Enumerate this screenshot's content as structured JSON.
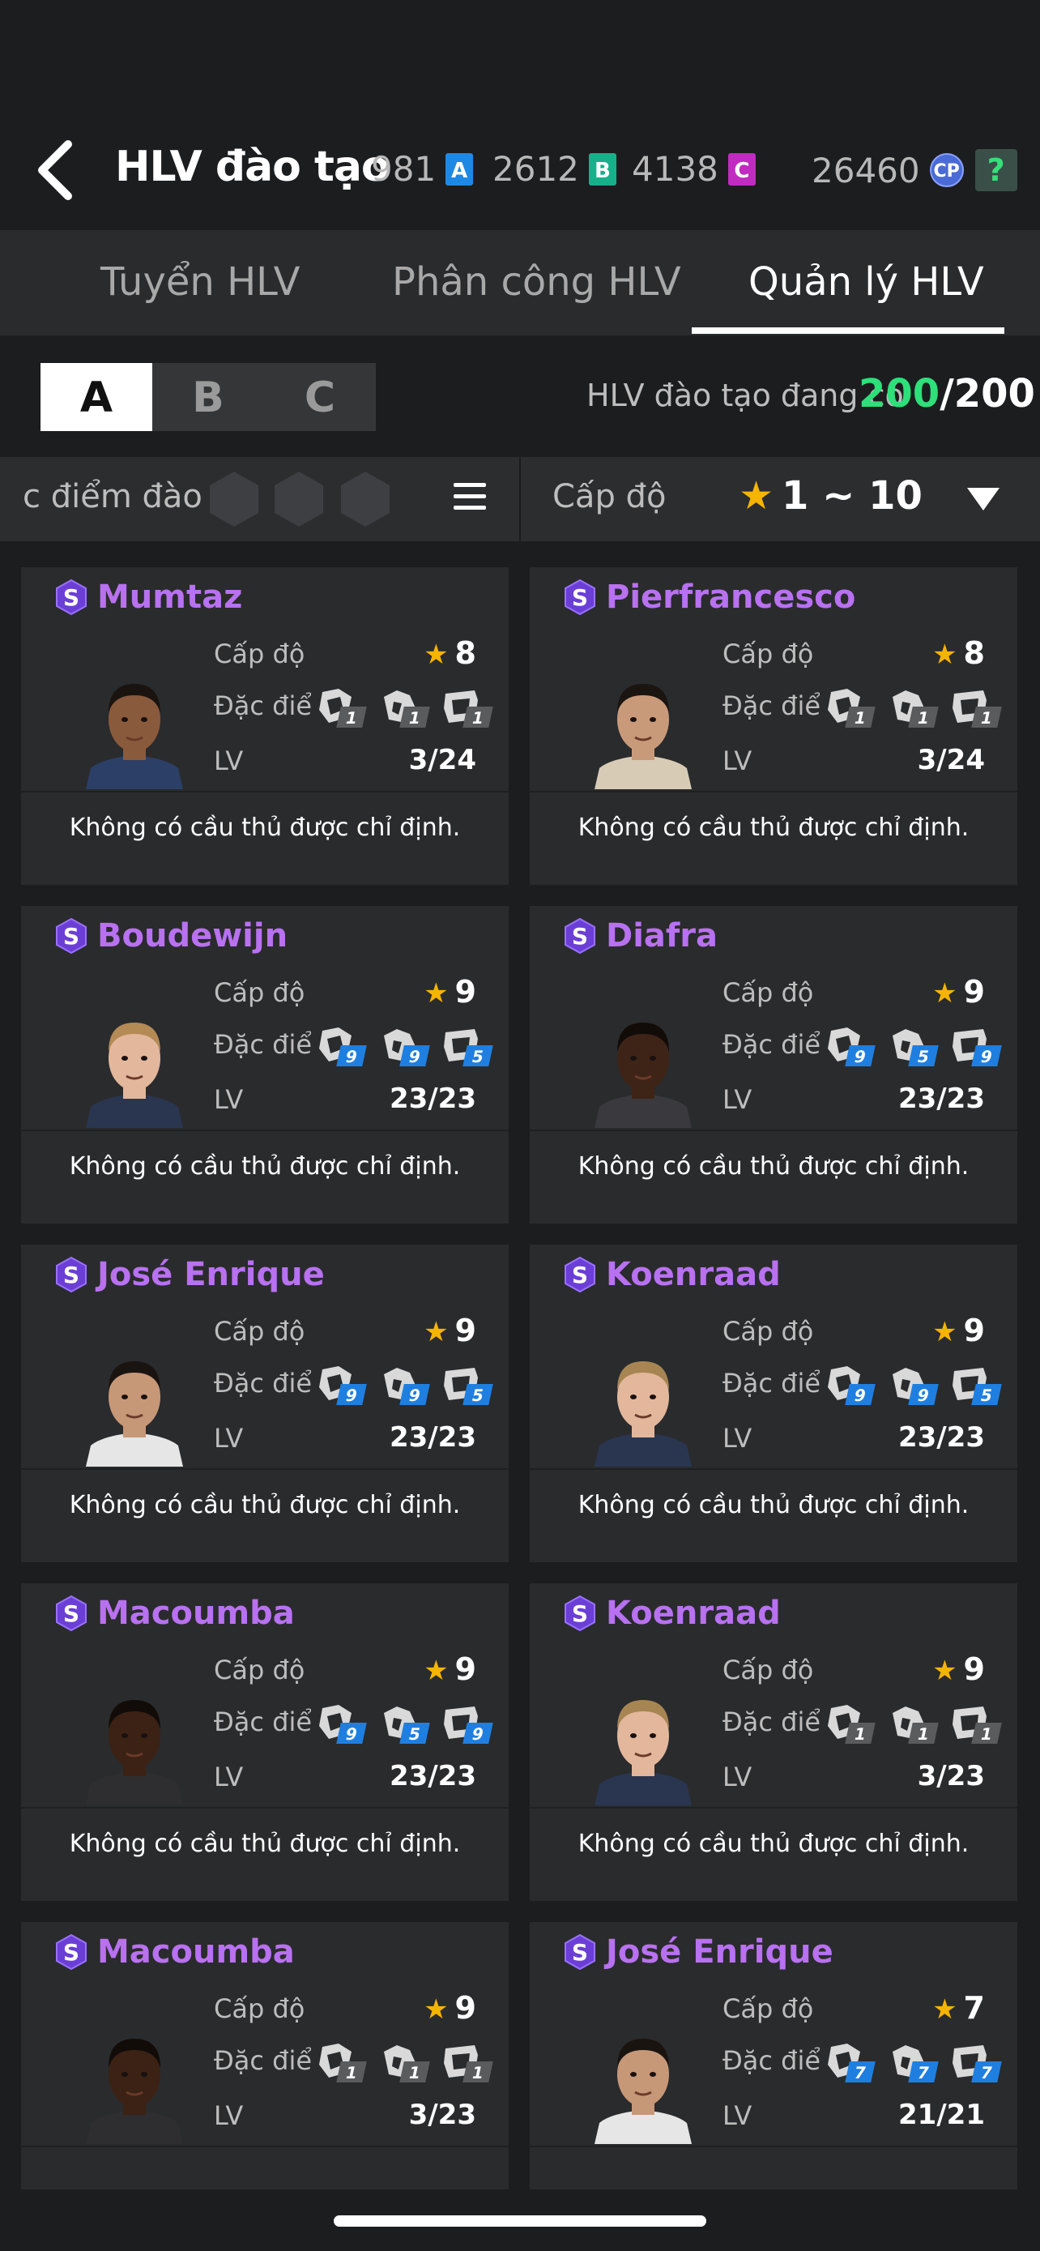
{
  "header": {
    "title": "HLV đào tạo",
    "currencies": [
      {
        "value": "981",
        "badge": "A",
        "color": "#1e88e5"
      },
      {
        "value": "2612",
        "badge": "B",
        "color": "#17b08a"
      },
      {
        "value": "4138",
        "badge": "C",
        "color": "#c02bc0"
      }
    ],
    "cp_value": "26460",
    "cp_label": "CP",
    "help_label": "?"
  },
  "tabs": [
    {
      "label": "Tuyển HLV",
      "active": false
    },
    {
      "label": "Phân công  HLV",
      "active": false
    },
    {
      "label": "Quản lý HLV",
      "active": true
    }
  ],
  "segments": [
    {
      "label": "A",
      "active": true
    },
    {
      "label": "B",
      "active": false
    },
    {
      "label": "C",
      "active": false
    }
  ],
  "coach_count": {
    "label": "HLV đào tạo đang có",
    "current": "200",
    "max": "/200"
  },
  "filter": {
    "traits_label": "c điểm đào",
    "level_label": "Cấp độ",
    "level_range": "1 ~ 10"
  },
  "card_labels": {
    "level": "Cấp độ",
    "traits": "Đặc điểm",
    "lv": "LV",
    "grade": "S"
  },
  "coaches": [
    {
      "name": "Mumtaz",
      "level": "8",
      "lv": "3/24",
      "traits": [
        {
          "v": "1",
          "c": "grey"
        },
        {
          "v": "1",
          "c": "grey"
        },
        {
          "v": "1",
          "c": "grey"
        }
      ],
      "assigned": "Không có cầu thủ được chỉ định.",
      "skin": "#8a5a3c",
      "hair": "#1a1410",
      "shirt": "#2c3f66"
    },
    {
      "name": "Pierfrancesco",
      "level": "8",
      "lv": "3/24",
      "traits": [
        {
          "v": "1",
          "c": "grey"
        },
        {
          "v": "1",
          "c": "grey"
        },
        {
          "v": "1",
          "c": "grey"
        }
      ],
      "assigned": "Không có cầu thủ được chỉ định.",
      "skin": "#c99a7a",
      "hair": "#1b1512",
      "shirt": "#d8cbb6"
    },
    {
      "name": "Boudewijn",
      "level": "9",
      "lv": "23/23",
      "traits": [
        {
          "v": "9",
          "c": "blue"
        },
        {
          "v": "9",
          "c": "blue"
        },
        {
          "v": "5",
          "c": "blue"
        }
      ],
      "assigned": "Không có cầu thủ được chỉ định.",
      "skin": "#e2b79c",
      "hair": "#b48a55",
      "shirt": "#2a3650"
    },
    {
      "name": "Diafra",
      "level": "9",
      "lv": "23/23",
      "traits": [
        {
          "v": "9",
          "c": "blue"
        },
        {
          "v": "5",
          "c": "blue"
        },
        {
          "v": "9",
          "c": "blue"
        }
      ],
      "assigned": "Không có cầu thủ được chỉ định.",
      "skin": "#3e2416",
      "hair": "#120c09",
      "shirt": "#3a3a3e"
    },
    {
      "name": "José Enrique",
      "level": "9",
      "lv": "23/23",
      "traits": [
        {
          "v": "9",
          "c": "blue"
        },
        {
          "v": "9",
          "c": "blue"
        },
        {
          "v": "5",
          "c": "blue"
        }
      ],
      "assigned": "Không có cầu thủ được chỉ định.",
      "skin": "#c69878",
      "hair": "#1a1410",
      "shirt": "#e6e6e6"
    },
    {
      "name": "Koenraad",
      "level": "9",
      "lv": "23/23",
      "traits": [
        {
          "v": "9",
          "c": "blue"
        },
        {
          "v": "9",
          "c": "blue"
        },
        {
          "v": "5",
          "c": "blue"
        }
      ],
      "assigned": "Không có cầu thủ được chỉ định.",
      "skin": "#e2b79c",
      "hair": "#a78553",
      "shirt": "#2a3650"
    },
    {
      "name": "Macoumba",
      "level": "9",
      "lv": "23/23",
      "traits": [
        {
          "v": "9",
          "c": "blue"
        },
        {
          "v": "5",
          "c": "blue"
        },
        {
          "v": "9",
          "c": "blue"
        }
      ],
      "assigned": "Không có cầu thủ được chỉ định.",
      "skin": "#3b2215",
      "hair": "#120c09",
      "shirt": "#2e2e30"
    },
    {
      "name": "Koenraad",
      "level": "9",
      "lv": "3/23",
      "traits": [
        {
          "v": "1",
          "c": "grey"
        },
        {
          "v": "1",
          "c": "grey"
        },
        {
          "v": "1",
          "c": "grey"
        }
      ],
      "assigned": "Không có cầu thủ được chỉ định.",
      "skin": "#e2b79c",
      "hair": "#a78553",
      "shirt": "#2a3650"
    },
    {
      "name": "Macoumba",
      "level": "9",
      "lv": "3/23",
      "traits": [
        {
          "v": "1",
          "c": "grey"
        },
        {
          "v": "1",
          "c": "grey"
        },
        {
          "v": "1",
          "c": "grey"
        }
      ],
      "assigned": "",
      "skin": "#3b2215",
      "hair": "#120c09",
      "shirt": "#2e2e30"
    },
    {
      "name": "José Enrique",
      "level": "7",
      "lv": "21/21",
      "traits": [
        {
          "v": "7",
          "c": "blue"
        },
        {
          "v": "7",
          "c": "blue"
        },
        {
          "v": "7",
          "c": "blue"
        }
      ],
      "assigned": "",
      "skin": "#c69878",
      "hair": "#1a1410",
      "shirt": "#e6e6e6"
    }
  ]
}
